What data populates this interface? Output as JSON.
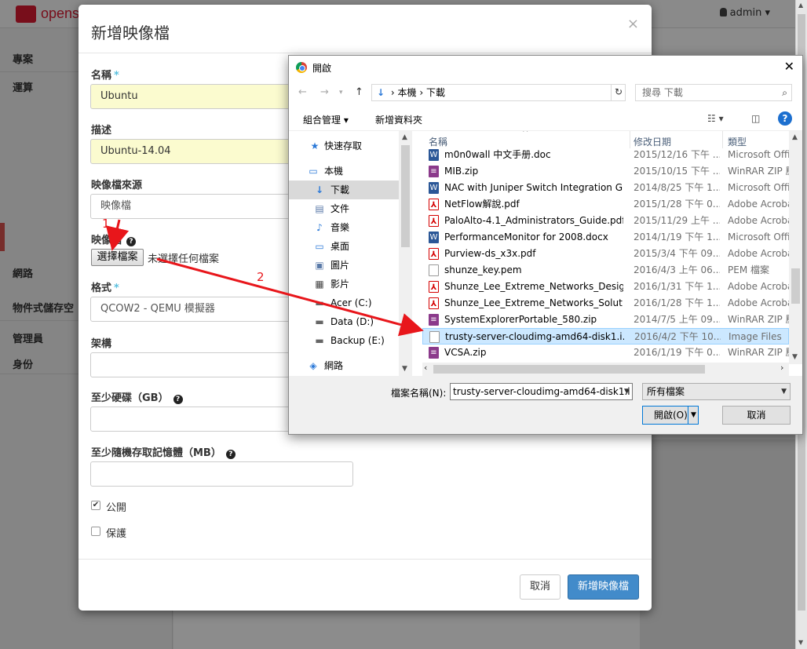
{
  "app": {
    "logo_text": "openst",
    "user_menu": "admin ▾",
    "sidebar": [
      "專案",
      "運算",
      "網路",
      "物件式儲存空",
      "管理員",
      "身份"
    ]
  },
  "modal": {
    "title": "新增映像檔",
    "close": "×",
    "name_label": "名稱",
    "name_value": "Ubuntu",
    "desc_label": "描述",
    "desc_value": "Ubuntu-14.04",
    "source_label": "映像檔來源",
    "source_value": "映像檔",
    "file_label": "映像檔",
    "file_button": "選擇檔案",
    "file_status": "未選擇任何檔案",
    "format_label": "格式",
    "format_value": "QCOW2 - QEMU 模擬器",
    "arch_label": "架構",
    "arch_value": "",
    "disk_label": "至少硬碟（GB）",
    "disk_value": "",
    "ram_label": "至少隨機存取記憶體（MB）",
    "ram_value": "",
    "public_label": "公開",
    "protect_label": "保護",
    "cancel_button": "取消",
    "submit_button": "新增映像檔"
  },
  "dialog": {
    "title": "開啟",
    "close": "✕",
    "breadcrumb": [
      "本機",
      "下載"
    ],
    "search_placeholder": "搜尋 下載",
    "organize": "組合管理 ▾",
    "new_folder": "新增資料夾",
    "nav_items": [
      {
        "label": "快速存取",
        "icon": "★"
      },
      {
        "label": "本機",
        "icon": "▭"
      },
      {
        "label": "下載",
        "icon": "↓"
      },
      {
        "label": "文件",
        "icon": "▤"
      },
      {
        "label": "音樂",
        "icon": "♪"
      },
      {
        "label": "桌面",
        "icon": "▭"
      },
      {
        "label": "圖片",
        "icon": "▣"
      },
      {
        "label": "影片",
        "icon": "▦"
      },
      {
        "label": "Acer (C:)",
        "icon": "▬"
      },
      {
        "label": "Data (D:)",
        "icon": "▬"
      },
      {
        "label": "Backup (E:)",
        "icon": "▬"
      },
      {
        "label": "網路",
        "icon": "◈"
      }
    ],
    "columns": [
      "名稱",
      "修改日期",
      "類型"
    ],
    "files": [
      {
        "name": "m0n0wall 中文手册.doc",
        "date": "2015/12/16 下午 ...",
        "type": "Microsoft Offic",
        "kind": "word"
      },
      {
        "name": "MIB.zip",
        "date": "2015/10/15 下午 ...",
        "type": "WinRAR ZIP 壓",
        "kind": "zip"
      },
      {
        "name": "NAC with Juniper Switch Integration G...",
        "date": "2014/8/25 下午 1...",
        "type": "Microsoft Offic",
        "kind": "word"
      },
      {
        "name": "NetFlow解說.pdf",
        "date": "2015/1/28 下午 0...",
        "type": "Adobe Acroba",
        "kind": "pdf"
      },
      {
        "name": "PaloAlto-4.1_Administrators_Guide.pdf",
        "date": "2015/11/29 上午 ...",
        "type": "Adobe Acroba",
        "kind": "pdf"
      },
      {
        "name": "PerformanceMonitor for 2008.docx",
        "date": "2014/1/19 下午 1...",
        "type": "Microsoft Offic",
        "kind": "word"
      },
      {
        "name": "Purview-ds_x3x.pdf",
        "date": "2015/3/4 下午 09...",
        "type": "Adobe Acroba",
        "kind": "pdf"
      },
      {
        "name": "shunze_key.pem",
        "date": "2016/4/3 上午 06...",
        "type": "PEM 檔案",
        "kind": "blank"
      },
      {
        "name": "Shunze_Lee_Extreme_Networks_Desig...",
        "date": "2016/1/31 下午 1...",
        "type": "Adobe Acroba",
        "kind": "pdf"
      },
      {
        "name": "Shunze_Lee_Extreme_Networks_Soluti...",
        "date": "2016/1/28 下午 1...",
        "type": "Adobe Acroba",
        "kind": "pdf"
      },
      {
        "name": "SystemExplorerPortable_580.zip",
        "date": "2014/7/5 上午 09...",
        "type": "WinRAR ZIP 壓",
        "kind": "zip"
      },
      {
        "name": "trusty-server-cloudimg-amd64-disk1.i...",
        "date": "2016/4/2 下午 10...",
        "type": "Image Files",
        "kind": "blank"
      },
      {
        "name": "VCSA.zip",
        "date": "2016/1/19 下午 0...",
        "type": "WinRAR ZIP 壓",
        "kind": "zip"
      }
    ],
    "filename_label": "檔案名稱(N):",
    "filename_value": "trusty-server-cloudimg-amd64-disk1.i",
    "filetype_value": "所有檔案",
    "open_button": "開啟(O)",
    "cancel_button": "取消"
  },
  "annotations": {
    "step1": "1",
    "step2": "2",
    "color": "#e8161b"
  }
}
